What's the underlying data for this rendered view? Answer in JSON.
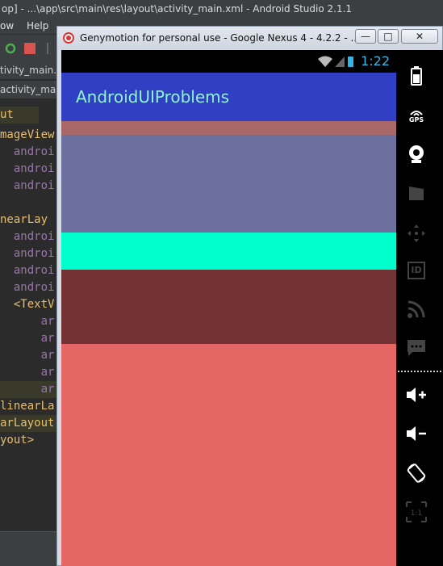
{
  "android_studio": {
    "title": "op] - ...\\app\\src\\main\\res\\layout\\activity_main.xml - Android Studio 2.1.1",
    "menu": [
      "ow",
      "Help"
    ],
    "tab_top": "tivity_main.xm",
    "tab_bottom": "activity_main",
    "code_lines": [
      "ut",
      "mageView",
      "  androi",
      "  androi",
      "  androi",
      "",
      "nearLay",
      "  androi",
      "  androi",
      "  androi",
      "  androi",
      "  <TextV",
      "      ar",
      "      ar",
      "      ar",
      "      ar",
      "      ar",
      "linearLa",
      "arLayout",
      "yout>"
    ]
  },
  "genymotion": {
    "title": "Genymotion for personal use - Google Nexus 4 - 4.2.2 - ...",
    "min_label": "—",
    "max_label": "□",
    "close_label": "✕"
  },
  "device": {
    "time": "1:22",
    "app_title": "AndroidUIProblems",
    "colors": {
      "actionbar": "#303fc4",
      "app_title": "#8ff5d0",
      "strip": "#a96868",
      "slate": "#6d6f9f",
      "aqua": "#00ffcc",
      "maroon": "#733234",
      "salmon": "#e66666"
    }
  },
  "sidebar": {
    "icons": [
      "battery-icon",
      "gps-icon",
      "webcam-icon",
      "clapperboard-icon",
      "dpad-icon",
      "id-icon",
      "rss-icon",
      "message-icon",
      "volume-up-icon",
      "volume-down-icon",
      "rotate-icon",
      "scale-icon"
    ],
    "gps_label": "GPS",
    "id_label": "ID",
    "scale_label": "1:1"
  }
}
